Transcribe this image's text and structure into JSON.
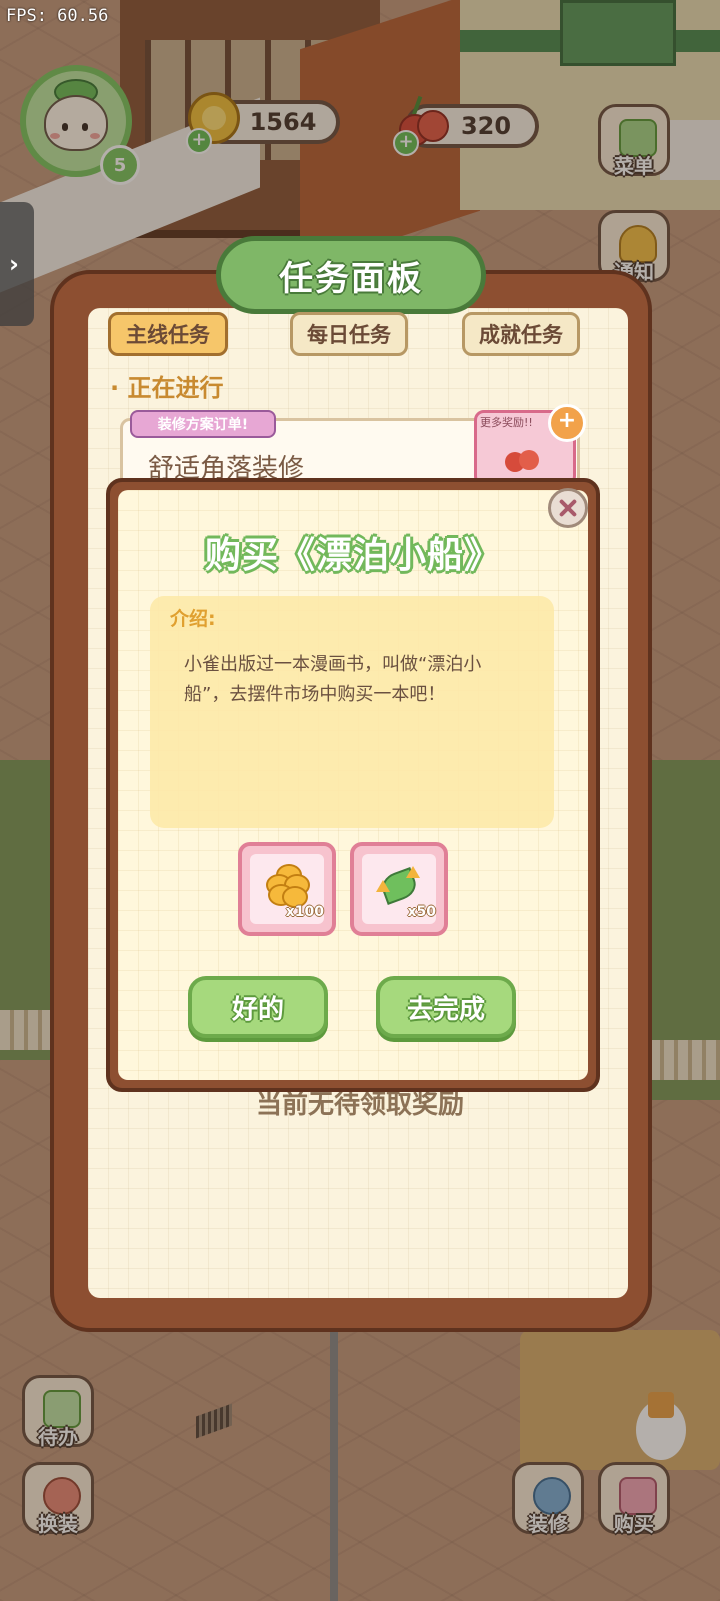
{
  "debug": {
    "fps": "FPS: 60.56"
  },
  "hud": {
    "level": "5",
    "coins": "1564",
    "cherries": "320"
  },
  "side_buttons": {
    "menu": "菜单",
    "notify": "通知",
    "todo": "待办",
    "dress": "换装",
    "decor": "装修",
    "buy": "购买"
  },
  "task_panel": {
    "title": "任务面板",
    "tabs": [
      "主线任务",
      "每日任务",
      "成就任务"
    ],
    "section": "· 正在进行",
    "task": {
      "tag": "装修方案订单!",
      "name": "舒适角落装修",
      "bonus_label": "更多奖励!!"
    },
    "empty_text": "当前无待领取奖励"
  },
  "dialog": {
    "title": "购买《漂泊小船》",
    "intro_label": "介绍:",
    "intro_text": "小雀出版过一本漫画书，叫做“漂泊小船”，去摆件市场中购买一本吧！",
    "rewards": [
      {
        "icon": "coin-pile-icon",
        "count": "x100"
      },
      {
        "icon": "leaf-growth-icon",
        "count": "x50"
      }
    ],
    "ok_label": "好的",
    "go_label": "去完成"
  },
  "colors": {
    "accent_green": "#72b85b",
    "panel_brown": "#8d4f31",
    "reward_pink": "#f7c3ce",
    "highlight_orange": "#f6c66a"
  }
}
